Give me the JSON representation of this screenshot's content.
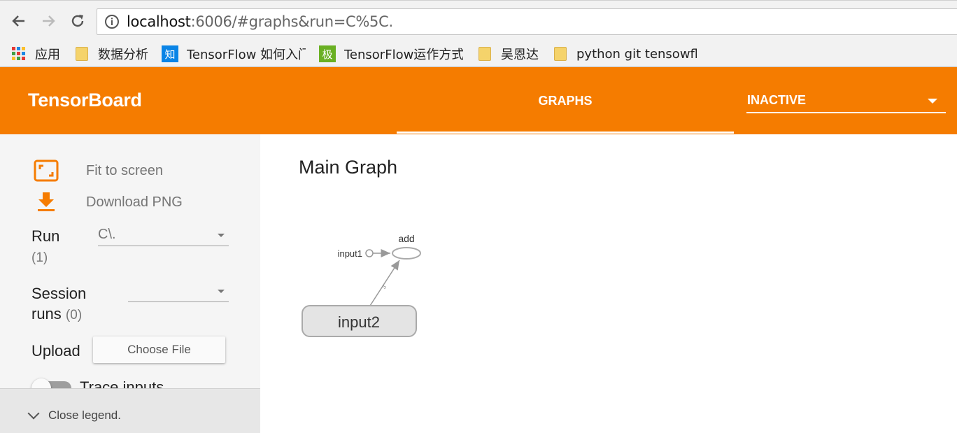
{
  "browser": {
    "url_host": "localhost",
    "url_rest": ":6006/#graphs&run=C%5C.",
    "bookmarks": [
      {
        "label": "应用",
        "icon": "apps-grid-icon"
      },
      {
        "label": "数据分析",
        "icon": "folder-icon"
      },
      {
        "label": "TensorFlow 如何入门",
        "icon": "zhihu-icon"
      },
      {
        "label": "TensorFlow运作方式",
        "icon": "ji-icon"
      },
      {
        "label": "吴恩达",
        "icon": "folder-icon"
      },
      {
        "label": "python git tensowfl",
        "icon": "folder-icon"
      }
    ],
    "zhihu_glyph": "知",
    "ji_glyph": "极"
  },
  "header": {
    "title": "TensorBoard",
    "active_tab": "GRAPHS",
    "plugin_select": "INACTIVE",
    "color": "#f57c00"
  },
  "sidebar": {
    "fit_label": "Fit to screen",
    "download_label": "Download PNG",
    "run_label": "Run",
    "run_count": "(1)",
    "run_value": "C\\.",
    "session_label_1": "Session",
    "session_label_2": "runs",
    "session_count": "(0)",
    "session_value": "",
    "upload_label": "Upload",
    "choose_file_label": "Choose File",
    "trace_label": "Trace inputs",
    "close_legend_label": "Close legend."
  },
  "main": {
    "title": "Main Graph",
    "graph": {
      "nodes": [
        "input1",
        "add",
        "input2"
      ],
      "edge_label": "3"
    }
  }
}
